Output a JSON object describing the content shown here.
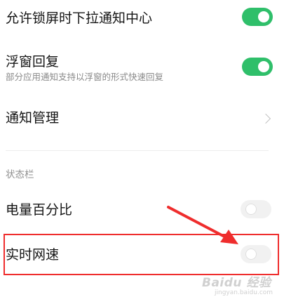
{
  "settings": {
    "lock_pull_down": {
      "title": "允许锁屏时下拉通知中心",
      "state": "on"
    },
    "floating_reply": {
      "title": "浮窗回复",
      "subtitle": "部分应用通知支持以浮窗的形式快速回复",
      "state": "on"
    },
    "notification_management": {
      "title": "通知管理"
    }
  },
  "status_bar_section": {
    "label": "状态栏",
    "battery_percentage": {
      "title": "电量百分比",
      "state": "off"
    },
    "realtime_network_speed": {
      "title": "实时网速",
      "state": "off"
    }
  },
  "annotation": {
    "highlight_color": "#ef2d2d",
    "arrow_color": "#ef2d2d"
  },
  "watermark": {
    "text": "Baidu 经验",
    "sub": "jingyan.baidu.com"
  },
  "colors": {
    "toggle_on": "#2fbf6a",
    "toggle_off": "#f1f1f1"
  }
}
